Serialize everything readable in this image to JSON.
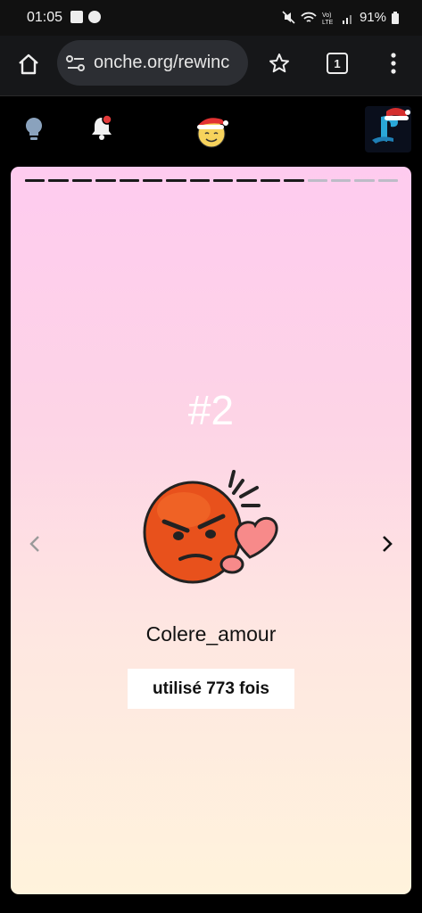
{
  "status_bar": {
    "time": "01:05",
    "battery": "91%",
    "icons": [
      "gallery-icon",
      "messenger-icon",
      "mute-icon",
      "wifi-icon",
      "volte-icon",
      "signal-icon",
      "battery-icon"
    ]
  },
  "browser": {
    "url": "onche.org/rewinc",
    "tab_count": "1",
    "icons": [
      "home-icon",
      "site-settings-icon",
      "star-icon",
      "tabs-icon",
      "more-icon"
    ]
  },
  "site_header": {
    "icons": [
      "lightbulb-icon",
      "notification-bell-icon",
      "santa-smiley-logo",
      "playstation-avatar"
    ]
  },
  "slide": {
    "rank": "#2",
    "emoji_name": "Colere_amour",
    "usage": "utilisé 773 fois",
    "progress_total_segments": 16,
    "progress_done_segments": 12,
    "prev_label": "‹",
    "next_label": "›"
  },
  "colors": {
    "gradient_top": "#fecbef",
    "gradient_bottom": "#fff3dc",
    "emoji_orange": "#e8511c",
    "heart_pink": "#f78a8a"
  }
}
